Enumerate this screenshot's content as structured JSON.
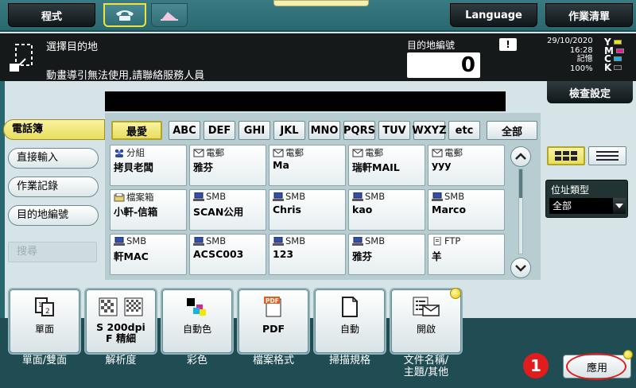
{
  "topbar": {
    "program_label": "程式",
    "language_label": "Language",
    "job_list_label": "作業清單"
  },
  "message": {
    "title": "選擇目的地",
    "warning": "動畫導引無法使用,請聯絡服務人員",
    "dest_count_label": "目的地編號",
    "dest_count": "0",
    "warn_icon": "!",
    "date": "29/10/2020",
    "time": "16:28",
    "memory_label": "記憶",
    "memory_value": "100%",
    "ink": [
      "Y",
      "M",
      "C",
      "K"
    ]
  },
  "check_settings_label": "檢查設定",
  "left_nav": {
    "items": [
      {
        "label": "電話簿"
      },
      {
        "label": "直接輸入"
      },
      {
        "label": "作業記錄"
      },
      {
        "label": "目的地編號"
      },
      {
        "label": "搜尋"
      }
    ]
  },
  "index": {
    "items": [
      "最愛",
      "ABC",
      "DEF",
      "GHI",
      "JKL",
      "MNO",
      "PQRS",
      "TUV",
      "WXYZ",
      "etc"
    ],
    "all_label": "全部"
  },
  "cards": [
    {
      "type": "分組",
      "icon": "group-icon",
      "name": "拷貝老闆"
    },
    {
      "type": "電郵",
      "icon": "email-icon",
      "name": "雅芬"
    },
    {
      "type": "電郵",
      "icon": "email-icon",
      "name": "Ma"
    },
    {
      "type": "電郵",
      "icon": "email-icon",
      "name": "瑞軒MAIL"
    },
    {
      "type": "電郵",
      "icon": "email-icon",
      "name": "yyy"
    },
    {
      "type": "檔案箱",
      "icon": "box-icon",
      "name": "小軒-信箱"
    },
    {
      "type": "SMB",
      "icon": "computer-icon",
      "name": "SCAN公用"
    },
    {
      "type": "SMB",
      "icon": "computer-icon",
      "name": "Chris"
    },
    {
      "type": "SMB",
      "icon": "computer-icon",
      "name": "kao"
    },
    {
      "type": "SMB",
      "icon": "computer-icon",
      "name": "Marco"
    },
    {
      "type": "SMB",
      "icon": "computer-icon",
      "name": "軒MAC"
    },
    {
      "type": "SMB",
      "icon": "computer-icon",
      "name": "ACSC003"
    },
    {
      "type": "SMB",
      "icon": "computer-icon",
      "name": "123"
    },
    {
      "type": "SMB",
      "icon": "computer-icon",
      "name": "雅芬"
    },
    {
      "type": "FTP",
      "icon": "ftp-icon",
      "name": "羊"
    }
  ],
  "address_type": {
    "label": "位址類型",
    "value": "全部"
  },
  "tiles": [
    {
      "value": "單面",
      "label": "單面/雙面",
      "icon": "duplex-icon"
    },
    {
      "value": "S 200dpi\nF 精細",
      "label": "解析度",
      "icon": "resolution-icon"
    },
    {
      "value": "自動色",
      "label": "彩色",
      "icon": "color-icon"
    },
    {
      "value": "PDF",
      "label": "檔案格式",
      "icon": "pdf-icon"
    },
    {
      "value": "自動",
      "label": "掃描規格",
      "icon": "page-icon"
    },
    {
      "value": "開啟",
      "label": "文件名稱/\n主題/其他",
      "icon": "doc-email-icon"
    }
  ],
  "step_number": "1",
  "apply_label": "應用"
}
